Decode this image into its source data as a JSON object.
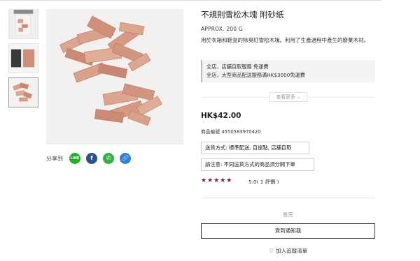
{
  "product": {
    "title": "不規則雪松木塊 附砂紙",
    "weight": "APPROX. 200 G",
    "description": "用於衣箱和鞋盒的除臭紅雪松木塊。利用了生產過程中產生的廢棄木材。"
  },
  "promotions": [
    "全店，店舖自取服務 免運費",
    "全店，大型商品配送服務滿HK$3000免運費"
  ],
  "more_button": "查看更多",
  "price": "HK$42.00",
  "product_code": "商品編號 4550583970420",
  "delivery_badge": "送貨方式: 標準配送, 自提點, 店舖自取",
  "notice_badge": "請注意: 不同送貨方式的商品須分開下單",
  "rating": {
    "stars": 5,
    "stars_display": "★★★★★",
    "text": "5.0( 1 評價 )"
  },
  "share": {
    "label": "分享到",
    "icons": [
      {
        "name": "line-icon",
        "glyph": "LINE",
        "color": "#22b22a"
      },
      {
        "name": "facebook-icon",
        "glyph": "f",
        "color": "#2f4f8f"
      },
      {
        "name": "whatsapp-icon",
        "glyph": "✆",
        "color": "#2fb344"
      },
      {
        "name": "link-icon",
        "glyph": "🔗",
        "color": "#2f7fe0"
      }
    ]
  },
  "sold_out_label": "售完",
  "notify_button": "貨到通知我",
  "wishlist_button": "加入追蹤清單",
  "colors": {
    "star": "#7a1a2a",
    "wood": "#d9a189",
    "wood_dark": "#c98670"
  }
}
